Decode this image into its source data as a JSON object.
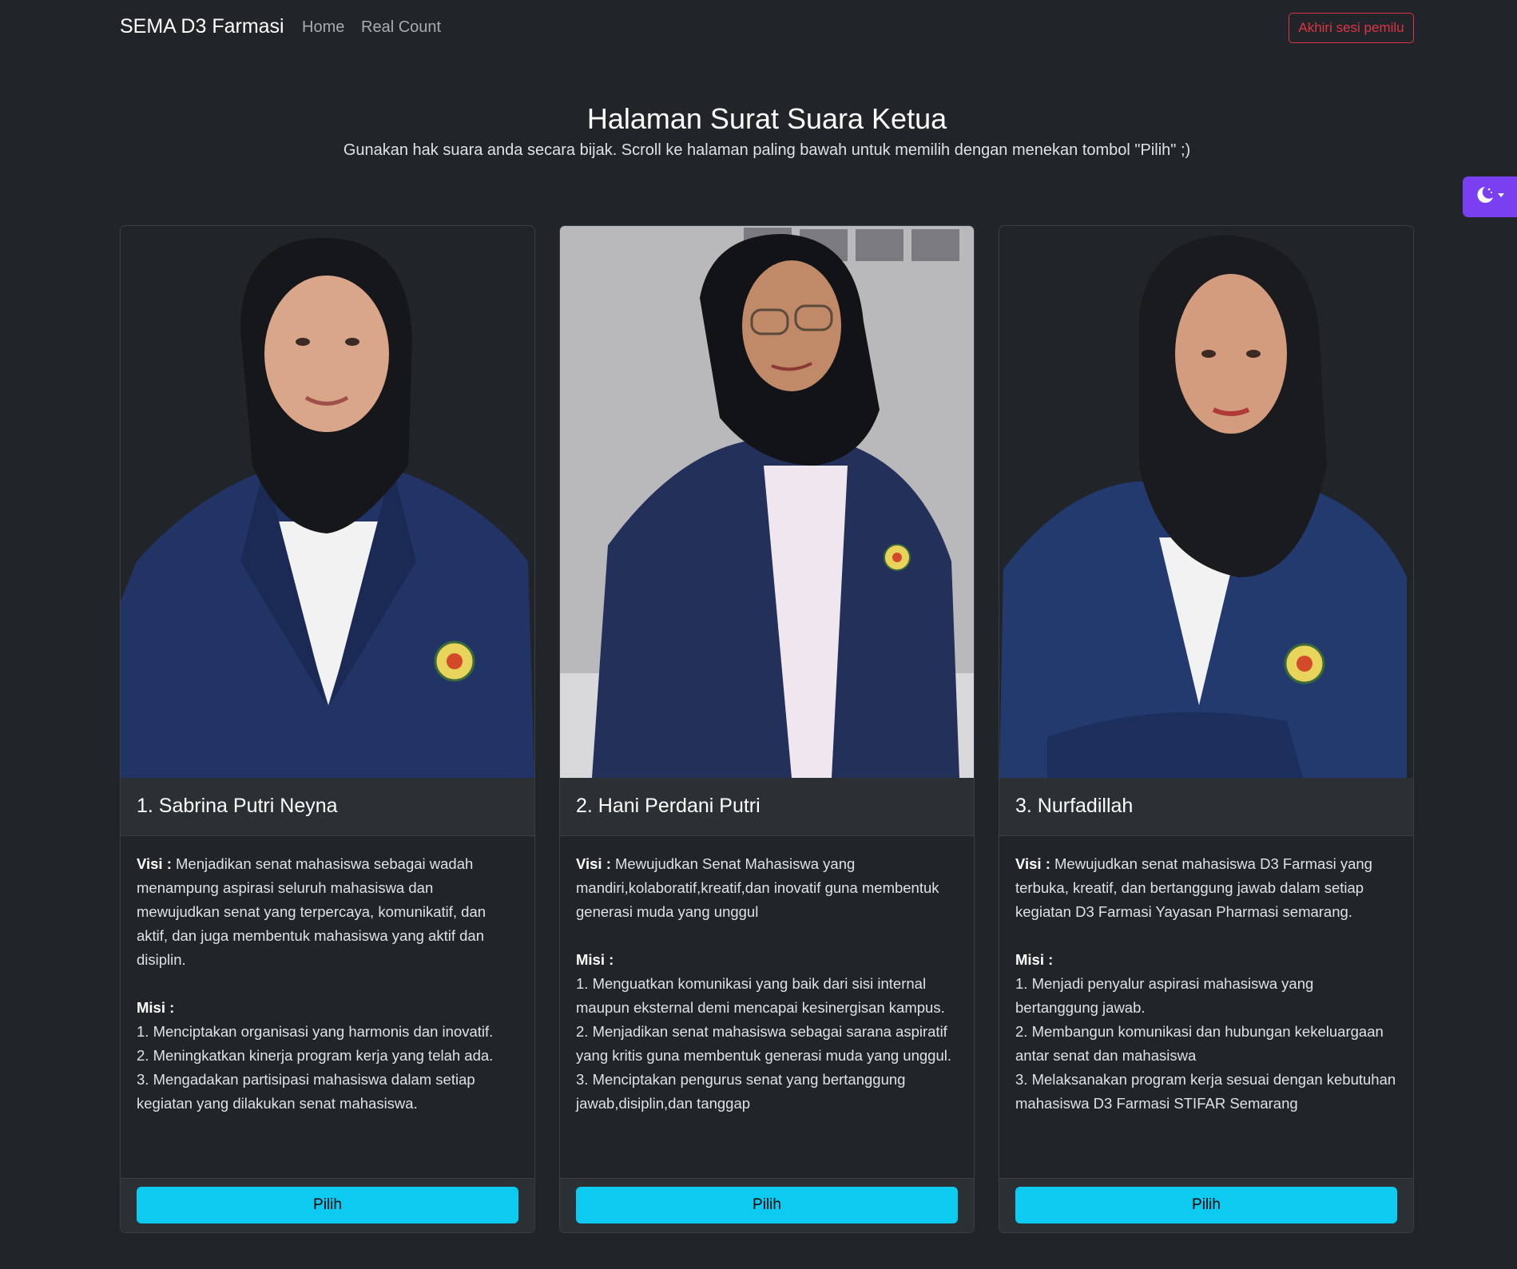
{
  "navbar": {
    "brand": "SEMA D3 Farmasi",
    "links": [
      "Home",
      "Real Count"
    ],
    "end_session_label": "Akhiri sesi pemilu"
  },
  "theme_toggle": {
    "icon": "moon-stars-icon"
  },
  "header": {
    "title": "Halaman Surat Suara Ketua",
    "subtitle": "Gunakan hak suara anda secara bijak. Scroll ke halaman paling bawah untuk memilih dengan menekan tombol \"Pilih\" ;)"
  },
  "candidates": [
    {
      "title": "1. Sabrina Putri Neyna",
      "visi_label": "Visi :",
      "visi": " Menjadikan senat mahasiswa sebagai wadah menampung aspirasi seluruh mahasiswa dan mewujudkan senat yang terpercaya, komunikatif, dan aktif, dan juga membentuk mahasiswa yang aktif dan disiplin.",
      "misi_label": "Misi :",
      "misi": [
        "1. Menciptakan organisasi yang harmonis dan inovatif.",
        "2. Meningkatkan kinerja program kerja yang telah ada.",
        "3. Mengadakan partisipasi mahasiswa dalam setiap kegiatan yang dilakukan senat mahasiswa."
      ],
      "button": "Pilih"
    },
    {
      "title": "2. Hani Perdani Putri",
      "visi_label": "Visi :",
      "visi": " Mewujudkan Senat Mahasiswa yang mandiri,kolaboratif,kreatif,dan inovatif guna membentuk generasi muda yang unggul",
      "misi_label": "Misi :",
      "misi": [
        "1. Menguatkan komunikasi yang baik dari sisi internal maupun eksternal demi mencapai kesinergisan kampus.",
        "2. Menjadikan senat mahasiswa sebagai sarana aspiratif yang kritis guna membentuk generasi muda yang unggul.",
        "3. Menciptakan pengurus senat yang bertanggung jawab,disiplin,dan tanggap"
      ],
      "button": "Pilih"
    },
    {
      "title": "3. Nurfadillah",
      "visi_label": "Visi :",
      "visi": " Mewujudkan senat mahasiswa D3 Farmasi yang terbuka, kreatif, dan bertanggung jawab dalam setiap kegiatan D3 Farmasi Yayasan Pharmasi semarang.",
      "misi_label": "Misi :",
      "misi": [
        "1. Menjadi penyalur aspirasi mahasiswa yang bertanggung jawab.",
        "2. Membangun komunikasi dan hubungan kekeluargaan antar senat dan mahasiswa",
        "3. Melaksanakan program kerja sesuai dengan kebutuhan mahasiswa D3 Farmasi STIFAR Semarang"
      ],
      "button": "Pilih"
    }
  ],
  "colors": {
    "background": "#212529",
    "accent_button": "#0dcaf0",
    "danger": "#dc3545",
    "toggle": "#7b3ff2"
  }
}
